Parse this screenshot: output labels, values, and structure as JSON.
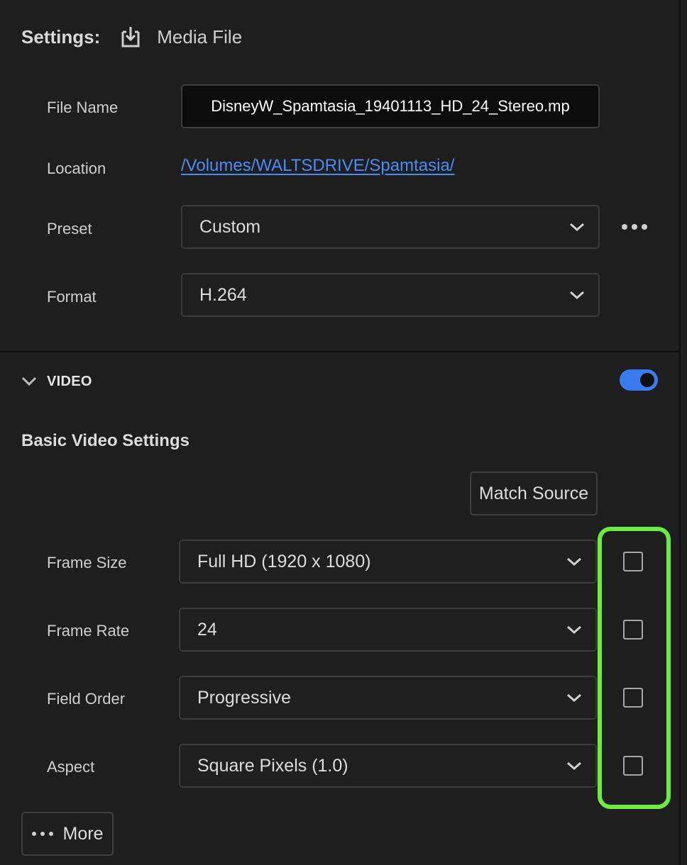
{
  "settings": {
    "label": "Settings:",
    "destination_icon": "download-tray-icon",
    "title": "Media File"
  },
  "file_name": {
    "label": "File Name",
    "value": "DisneyW_Spamtasia_19401113_HD_24_Stereo.mp"
  },
  "location": {
    "label": "Location",
    "path": "/Volumes/WALTSDRIVE/Spamtasia/"
  },
  "preset": {
    "label": "Preset",
    "value": "Custom",
    "more_icon": "ellipsis-icon"
  },
  "format": {
    "label": "Format",
    "value": "H.264"
  },
  "video": {
    "label": "VIDEO",
    "enabled": true,
    "toggle_color": "#3a7bf0"
  },
  "basic_video": {
    "title": "Basic Video Settings",
    "match_source_label": "Match Source",
    "rows": [
      {
        "label": "Frame Size",
        "value": "Full HD (1920 x 1080)",
        "checked": false
      },
      {
        "label": "Frame Rate",
        "value": "24",
        "checked": false
      },
      {
        "label": "Field Order",
        "value": "Progressive",
        "checked": false
      },
      {
        "label": "Aspect",
        "value": "Square Pixels (1.0)",
        "checked": false
      }
    ],
    "highlight_color": "#6cec3c"
  },
  "more_button": {
    "label": "More"
  },
  "colors": {
    "background": "#1e1e1e",
    "link": "#4b8bf5",
    "accent": "#3a7bf0"
  }
}
